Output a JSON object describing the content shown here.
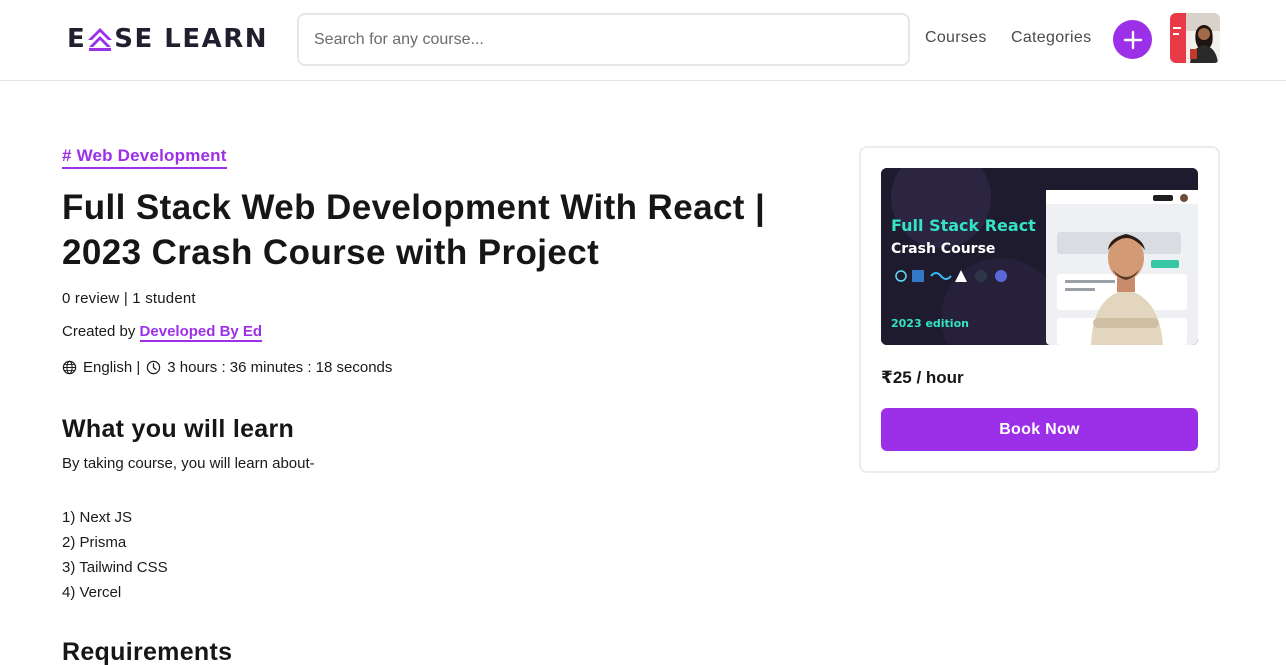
{
  "header": {
    "logo_text": "EASE LEARN",
    "logo_left": "E",
    "logo_right": "SE LEARN",
    "search_placeholder": "Search for any course...",
    "nav": {
      "courses": "Courses",
      "categories": "Categories"
    },
    "icons": {
      "add": "plus-icon",
      "avatar": "user-avatar"
    }
  },
  "course": {
    "category": "# Web Development",
    "title": "Full Stack Web Development With React | 2023 Crash Course with Project",
    "reviews_students": "0 review | 1 student",
    "created_by_label": "Created by",
    "author": "Developed By Ed",
    "language": "English |",
    "duration": "3 hours : 36 minutes : 18 seconds",
    "icons": {
      "language": "globe-icon",
      "duration": "clock-icon"
    }
  },
  "learn": {
    "heading": "What you will learn",
    "intro": "By taking course, you will learn about-",
    "items": [
      "1) Next JS",
      "2) Prisma",
      "3) Tailwind CSS",
      "4) Vercel"
    ]
  },
  "requirements": {
    "heading": "Requirements"
  },
  "card": {
    "thumbnail": {
      "line1": "Full Stack React",
      "line2": "Crash Course",
      "edition": "2023 edition"
    },
    "price": "₹25 / hour",
    "book_label": "Book Now"
  },
  "colors": {
    "accent": "#9b30e8",
    "text": "#161616",
    "thumb_teal": "#34e3c4"
  }
}
